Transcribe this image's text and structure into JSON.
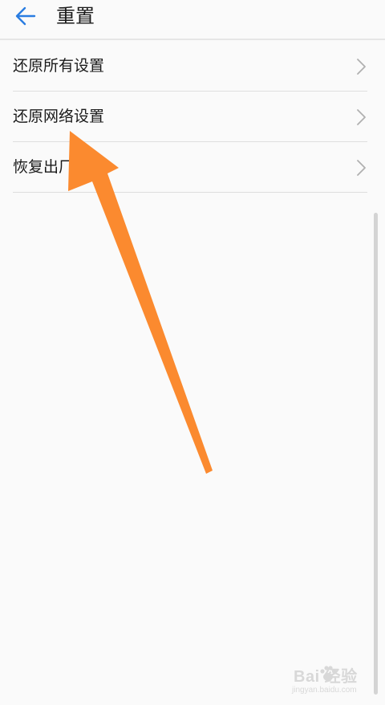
{
  "header": {
    "back_icon": "arrow-left-icon",
    "title": "重置"
  },
  "settings_list": [
    {
      "label": "还原所有设置",
      "icon": "chevron-right-icon"
    },
    {
      "label": "还原网络设置",
      "icon": "chevron-right-icon"
    },
    {
      "label": "恢复出厂设置",
      "icon": "chevron-right-icon"
    }
  ],
  "colors": {
    "accent": "#2a7de1",
    "arrow": "#fb8a2f",
    "background": "#fafafa"
  },
  "watermark": {
    "logo": "Bai  经验",
    "url": "jingyan.baidu.com"
  }
}
